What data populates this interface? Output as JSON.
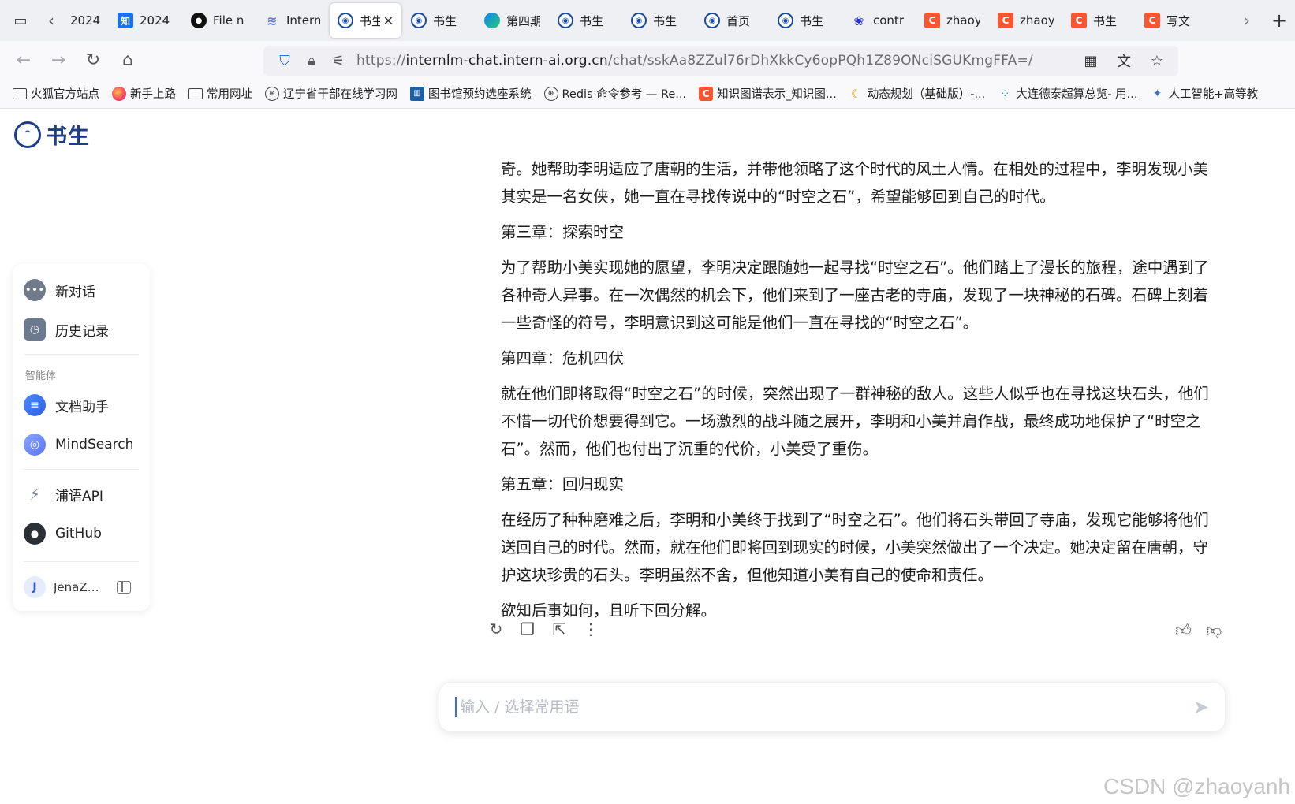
{
  "tabs": [
    {
      "title": "2024",
      "icon": "text",
      "fav": ""
    },
    {
      "title": "2024",
      "icon": "zhihu-icon",
      "fav": "知"
    },
    {
      "title": "File n",
      "icon": "github-icon",
      "fav": "●"
    },
    {
      "title": "Intern",
      "icon": "wave-icon",
      "fav": "≋"
    },
    {
      "title": "书生",
      "icon": "bot-icon",
      "fav": "◉",
      "active": true
    },
    {
      "title": "书生",
      "icon": "bot-icon",
      "fav": "◉"
    },
    {
      "title": "第四期",
      "icon": "edge-icon",
      "fav": ""
    },
    {
      "title": "书生",
      "icon": "bot-icon",
      "fav": "◉"
    },
    {
      "title": "书生",
      "icon": "bot-icon",
      "fav": "◉"
    },
    {
      "title": "首页",
      "icon": "bot-icon",
      "fav": "◉"
    },
    {
      "title": "书生",
      "icon": "bot-icon",
      "fav": "◉"
    },
    {
      "title": "contr",
      "icon": "baidu-icon",
      "fav": "❀"
    },
    {
      "title": "zhaoy",
      "icon": "csdn-icon",
      "fav": "C"
    },
    {
      "title": "zhaoy",
      "icon": "csdn-icon",
      "fav": "C"
    },
    {
      "title": "书生",
      "icon": "csdn-icon",
      "fav": "C"
    },
    {
      "title": "写文",
      "icon": "csdn-icon",
      "fav": "C"
    }
  ],
  "nav": {
    "url_prefix": "https://",
    "url_domain": "internlm-chat.intern-ai.org.cn",
    "url_path": "/chat/sskAa8ZZul76rDhXkkCy6opPQh1Z89ONciSGUKmgFFA=/"
  },
  "bookmarks": [
    {
      "label": "火狐官方站点",
      "icon": "folder"
    },
    {
      "label": "新手上路",
      "icon": "ff"
    },
    {
      "label": "常用网址",
      "icon": "folder"
    },
    {
      "label": "辽宁省干部在线学习网",
      "icon": "globe"
    },
    {
      "label": "图书馆预约选座系统",
      "icon": "lib"
    },
    {
      "label": "Redis 命令参考 — Re...",
      "icon": "globe"
    },
    {
      "label": "知识图谱表示_知识图...",
      "icon": "c"
    },
    {
      "label": "动态规划（基础版）-...",
      "icon": "dp"
    },
    {
      "label": "大连德泰超算总览- 用...",
      "icon": "dots"
    },
    {
      "label": "人工智能+高等教",
      "icon": "ai"
    }
  ],
  "app": {
    "logo_text": "书生"
  },
  "sidebar": {
    "new_chat": "新对话",
    "history": "历史记录",
    "group_label": "智能体",
    "doc_assistant": "文档助手",
    "mindsearch": "MindSearch",
    "api": "浦语API",
    "github": "GitHub",
    "user_initial": "J",
    "user_name": "JenaZ…"
  },
  "message": {
    "paragraphs": [
      "奇。她帮助李明适应了唐朝的生活，并带他领略了这个时代的风土人情。在相处的过程中，李明发现小美其实是一名女侠，她一直在寻找传说中的“时空之石”，希望能够回到自己的时代。",
      "第三章：探索时空",
      "为了帮助小美实现她的愿望，李明决定跟随她一起寻找“时空之石”。他们踏上了漫长的旅程，途中遇到了各种奇人异事。在一次偶然的机会下，他们来到了一座古老的寺庙，发现了一块神秘的石碑。石碑上刻着一些奇怪的符号，李明意识到这可能是他们一直在寻找的“时空之石”。",
      "第四章：危机四伏",
      "就在他们即将取得“时空之石”的时候，突然出现了一群神秘的敌人。这些人似乎也在寻找这块石头，他们不惜一切代价想要得到它。一场激烈的战斗随之展开，李明和小美并肩作战，最终成功地保护了“时空之石”。然而，他们也付出了沉重的代价，小美受了重伤。",
      "第五章：回归现实",
      "在经历了种种磨难之后，李明和小美终于找到了“时空之石”。他们将石头带回了寺庙，发现它能够将他们送回自己的时代。然而，就在他们即将回到现实的时候，小美突然做出了一个决定。她决定留在唐朝，守护这块珍贵的石头。李明虽然不舍，但他知道小美有自己的使命和责任。",
      "欲知后事如何，且听下回分解。"
    ]
  },
  "composer": {
    "placeholder": "输入 / 选择常用语",
    "value": ""
  },
  "watermark": "CSDN @zhaoyanh"
}
